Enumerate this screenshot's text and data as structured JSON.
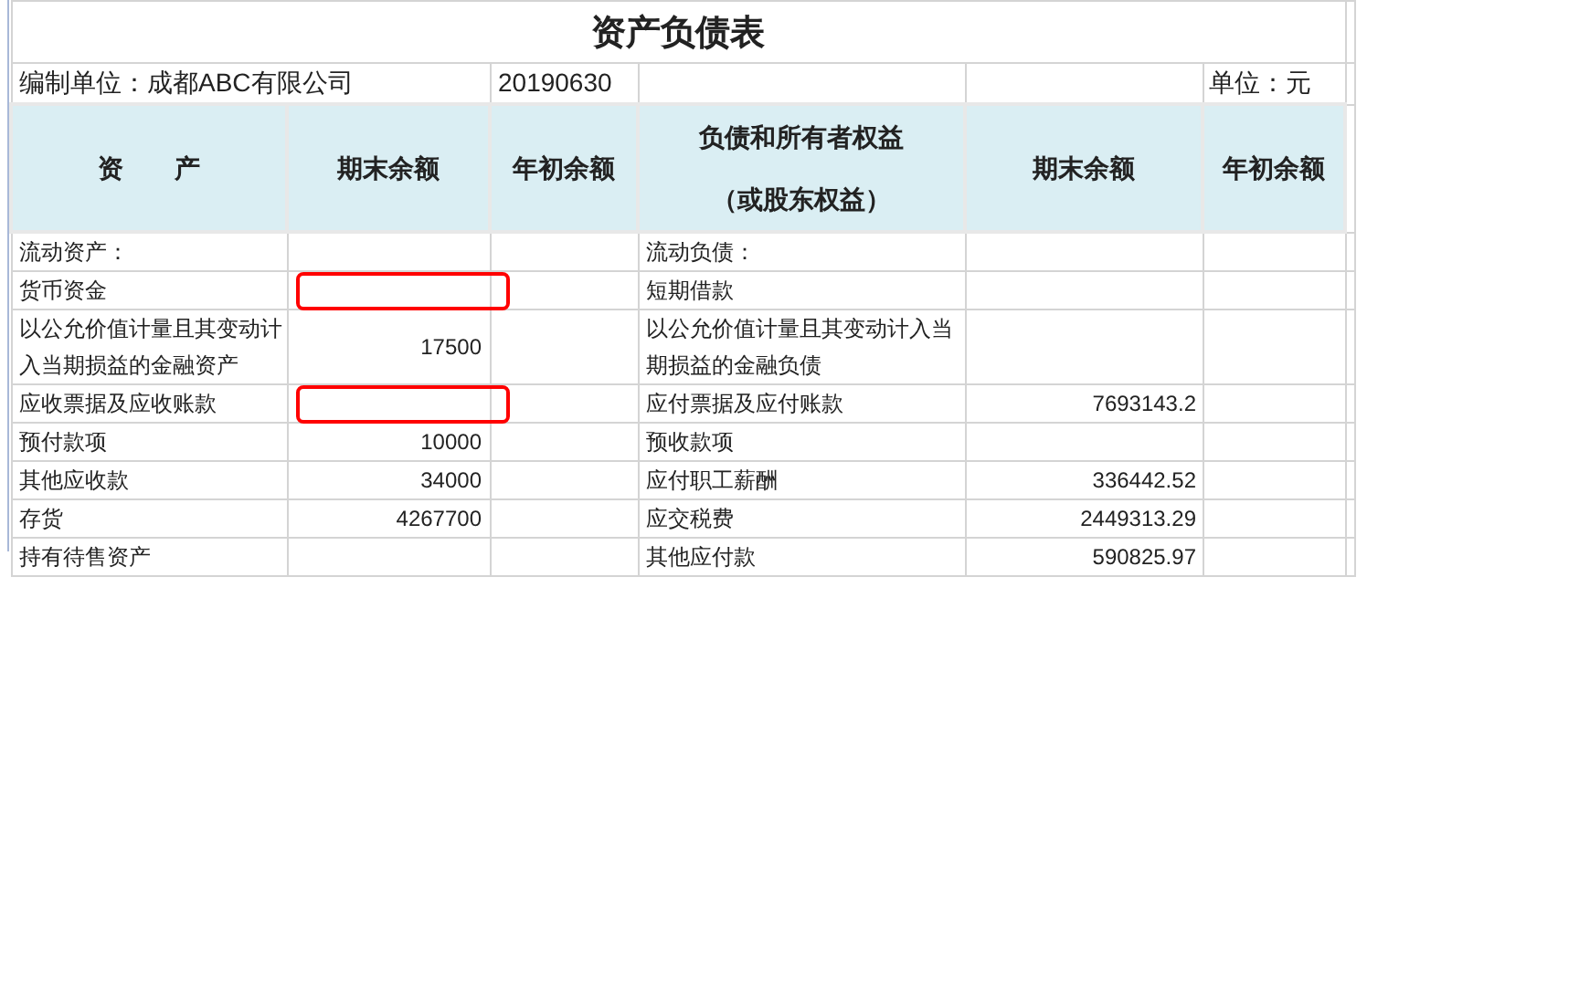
{
  "title": "资产负债表",
  "info": {
    "company": "编制单位：成都ABC有限公司",
    "date": "20190630",
    "unit": "单位：元"
  },
  "columns": [
    [
      "资　　产"
    ],
    [
      "期末余额"
    ],
    [
      "年初余额"
    ],
    [
      "负债和所有者权益",
      "（或股东权益）"
    ],
    [
      "期末余额"
    ],
    [
      "年初余额"
    ]
  ],
  "rows": [
    {
      "asset": "流动资产：",
      "liability": "流动负债：",
      "highlighted": false
    },
    {
      "asset": "货币资金",
      "liability": "短期借款",
      "highlighted": true
    },
    {
      "asset": "以公允价值计量且其变动计入当期损益的金融资产",
      "asset_end": "17500",
      "liability": "以公允价值计量且其变动计入当期损益的金融负债",
      "highlighted": false
    },
    {
      "asset": "应收票据及应收账款",
      "liability": "应付票据及应付账款",
      "liability_end": "7693143.2",
      "highlighted": true
    },
    {
      "asset": "预付款项",
      "asset_end": "10000",
      "liability": "预收款项",
      "highlighted": false
    },
    {
      "asset": "其他应收款",
      "asset_end": "34000",
      "liability": "应付职工薪酬",
      "liability_end": "336442.52",
      "highlighted": false
    },
    {
      "asset": "存货",
      "asset_end": "4267700",
      "liability": "应交税费",
      "liability_end": "2449313.29",
      "highlighted": false
    },
    {
      "asset": "持有待售资产",
      "liability": "其他应付款",
      "liability_end": "590825.97",
      "highlighted": false
    }
  ]
}
